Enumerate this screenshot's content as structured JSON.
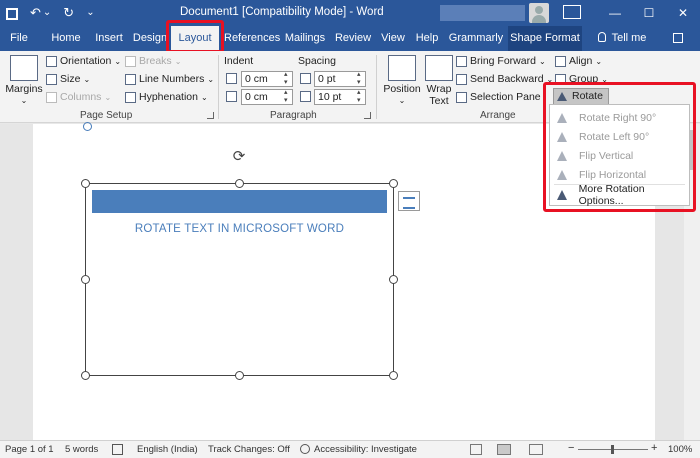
{
  "titlebar": {
    "save_icon": "save-icon",
    "undo_glyph": "↶",
    "undo_arrow": "⌄",
    "redo_glyph": "↻",
    "customize_glyph": "⌄",
    "title": "Document1 [Compatibility Mode]  -  Word",
    "minimize": "—",
    "maximize": "☐",
    "close": "✕"
  },
  "tabs": [
    "File",
    "Home",
    "Insert",
    "Design",
    "Layout",
    "References",
    "Mailings",
    "Review",
    "View",
    "Help",
    "Grammarly",
    "Shape Format",
    "Tell me"
  ],
  "ribbon": {
    "page_setup": {
      "margins": "Margins",
      "orientation": "Orientation",
      "size": "Size",
      "columns": "Columns",
      "breaks": "Breaks",
      "line_numbers": "Line Numbers",
      "hyphenation": "Hyphenation",
      "label": "Page Setup"
    },
    "paragraph": {
      "indent_label": "Indent",
      "spacing_label": "Spacing",
      "indent_left": "0 cm",
      "indent_right": "0 cm",
      "spacing_before": "0 pt",
      "spacing_after": "10 pt",
      "label": "Paragraph"
    },
    "arrange": {
      "position": "Position",
      "wrap_text": "Wrap\nText",
      "bring_forward": "Bring Forward",
      "send_backward": "Send Backward",
      "selection_pane": "Selection Pane",
      "align": "Align",
      "group": "Group",
      "rotate": "Rotate",
      "label": "Arrange"
    }
  },
  "document": {
    "heading_text": "ROTATE TEXT IN MICROSOFT WORD",
    "rotate_handle": "⟳"
  },
  "rotate_menu": {
    "items": [
      {
        "label": "Rotate Right 90°",
        "enabled": false
      },
      {
        "label": "Rotate Left 90°",
        "enabled": false
      },
      {
        "label": "Flip Vertical",
        "enabled": false
      },
      {
        "label": "Flip Horizontal",
        "enabled": false
      },
      {
        "label": "More Rotation Options...",
        "enabled": true
      }
    ]
  },
  "statusbar": {
    "page": "Page 1 of 1",
    "words": "5 words",
    "language": "English (India)",
    "track_changes": "Track Changes: Off",
    "accessibility": "Accessibility: Investigate",
    "zoom_minus": "−",
    "zoom_plus": "+",
    "zoom": "100%"
  },
  "colors": {
    "word_blue": "#2b579a",
    "highlight_red": "#e81123",
    "text_blue": "#4a7ebb"
  }
}
